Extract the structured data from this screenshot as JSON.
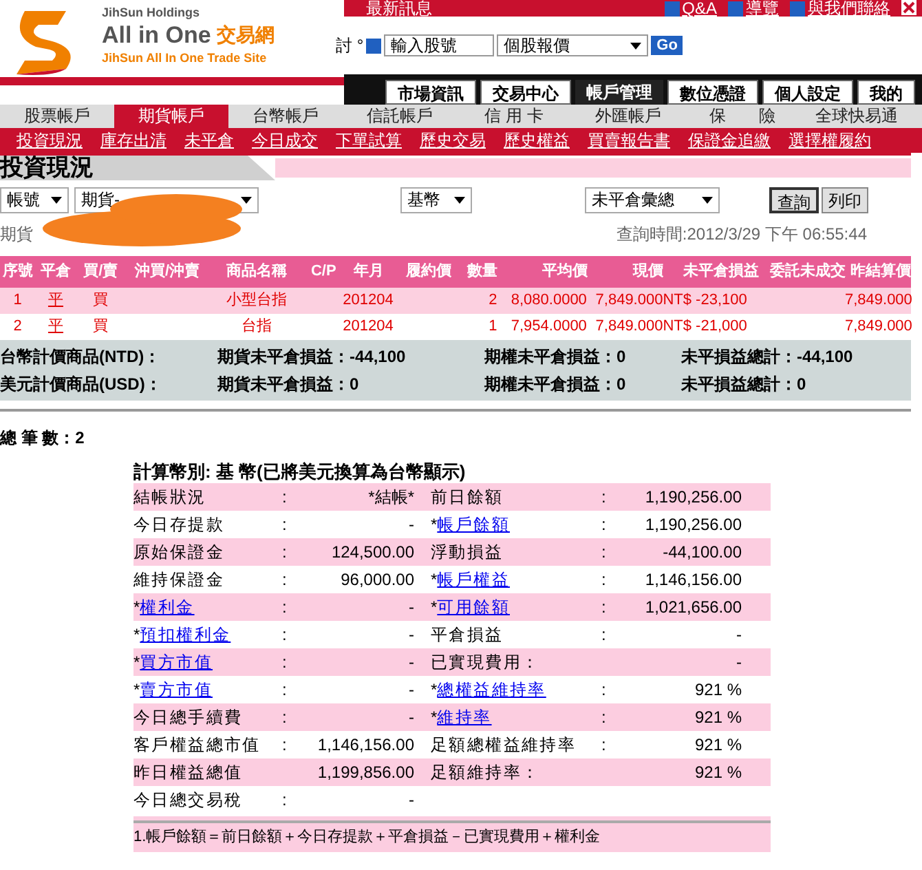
{
  "brand": {
    "holdings": "JihSun Holdings",
    "name": "All in One",
    "name_cjk": "交易網",
    "tagline": "JihSun All In One Trade Site"
  },
  "top_bar": {
    "news": "最新訊息",
    "links": [
      "Q&A",
      "導覽",
      "與我們聯絡"
    ]
  },
  "quote_search": {
    "cut_text": "討 °",
    "input_value": "輸入股號",
    "select_value": "個股報價",
    "button": "Go"
  },
  "main_tabs": [
    {
      "label": "市場資訊",
      "selected": false
    },
    {
      "label": "交易中心",
      "selected": false
    },
    {
      "label": "帳戶管理",
      "selected": true
    },
    {
      "label": "數位憑證",
      "selected": false
    },
    {
      "label": "個人設定",
      "selected": false
    },
    {
      "label": "我的",
      "selected": false
    }
  ],
  "account_tabs": [
    {
      "label": "股票帳戶",
      "selected": false
    },
    {
      "label": "期貨帳戶",
      "selected": true
    },
    {
      "label": "台幣帳戶",
      "selected": false
    },
    {
      "label": "信託帳戶",
      "selected": false
    },
    {
      "label": "信 用 卡",
      "selected": false
    },
    {
      "label": "外匯帳戶",
      "selected": false
    },
    {
      "label": "保　　險",
      "selected": false
    },
    {
      "label": "全球快易通",
      "selected": false
    }
  ],
  "sub_links": [
    "投資現況",
    "庫存出清",
    "未平倉",
    "今日成交",
    "下單試算",
    "歷史交易",
    "歷史權益",
    "買賣報告書",
    "保證金追繳",
    "選擇權履約"
  ],
  "section_title": "投資現況",
  "filters": {
    "account": "帳號",
    "futures_account": "期貨-",
    "currency": "基幣",
    "view": "未平倉彙總",
    "buttons": [
      "查詢",
      "列印"
    ]
  },
  "account_line": "期貨",
  "query_time": "查詢時間:2012/3/29 下午 06:55:44",
  "positions": {
    "columns": [
      "序號",
      "平倉",
      "買/賣",
      "沖買/沖賣",
      "商品名稱",
      "C/P",
      "年月",
      "履約價",
      "數量",
      "平均價",
      "現價",
      "未平倉損益",
      "委託未成交",
      "昨結算價"
    ],
    "rows": [
      {
        "cells": [
          "1",
          "平",
          "買",
          "",
          "小型台指",
          "",
          "201204",
          "",
          "2",
          "8,080.0000",
          "7,849.000",
          "NT$ -23,100",
          "",
          "7,849.000"
        ]
      },
      {
        "cells": [
          "2",
          "平",
          "買",
          "",
          "台指",
          "",
          "201204",
          "",
          "1",
          "7,954.0000",
          "7,849.000",
          "NT$ -21,000",
          "",
          "7,849.000"
        ]
      }
    ]
  },
  "totals": [
    {
      "label": "台幣計價商品(NTD)：",
      "futures": "期貨未平倉損益：-44,100",
      "options": "期權未平倉損益：0",
      "sum": "未平損益總計：-44,100"
    },
    {
      "label": "美元計價商品(USD)：",
      "futures": "期貨未平倉損益：0",
      "options": "期權未平倉損益：0",
      "sum": "未平損益總計：0"
    }
  ],
  "record_count": "總 筆 數：2",
  "equity": {
    "title": "計算幣別: 基 幣(已將美元換算為台幣顯示)",
    "rows": [
      {
        "left": {
          "label": "結帳狀況",
          "colon": ":",
          "value": "*結帳*"
        },
        "right": {
          "label": "前日餘額",
          "colon": ":",
          "value": "1,190,256.00"
        }
      },
      {
        "left": {
          "label": "今日存提款",
          "colon": ":",
          "value": "-"
        },
        "right": {
          "star": "*",
          "label": "帳戶餘額",
          "link": true,
          "colon": ":",
          "value": "1,190,256.00"
        }
      },
      {
        "left": {
          "label": "原始保證金",
          "colon": ":",
          "value": "124,500.00"
        },
        "right": {
          "label": "浮動損益",
          "colon": ":",
          "value": "-44,100.00"
        }
      },
      {
        "left": {
          "label": "維持保證金",
          "colon": ":",
          "value": "96,000.00"
        },
        "right": {
          "star": "*",
          "label": "帳戶權益",
          "link": true,
          "colon": ":",
          "value": "1,146,156.00"
        }
      },
      {
        "left": {
          "star": "*",
          "label": "權利金",
          "link": true,
          "colon": ":",
          "value": "-"
        },
        "right": {
          "star": "*",
          "label": "可用餘額",
          "link": true,
          "colon": ":",
          "value": "1,021,656.00"
        }
      },
      {
        "left": {
          "star": "*",
          "label": "預扣權利金",
          "link": true,
          "colon": ":",
          "value": "-"
        },
        "right": {
          "label": "平倉損益",
          "colon": ":",
          "value": "-"
        }
      },
      {
        "left": {
          "star": "*",
          "label": "買方市值",
          "link": true,
          "colon": ":",
          "value": "-"
        },
        "right": {
          "label": "已實現費用：",
          "value": "-"
        }
      },
      {
        "left": {
          "star": "*",
          "label": "賣方市值",
          "link": true,
          "colon": ":",
          "value": "-"
        },
        "right": {
          "star": "*",
          "label": "總權益維持率",
          "link": true,
          "colon": ":",
          "value": "921 %"
        }
      },
      {
        "left": {
          "label": "今日總手續費",
          "colon": ":",
          "value": "-"
        },
        "right": {
          "star": "*",
          "label": "維持率",
          "link": true,
          "colon": ":",
          "value": "921 %"
        }
      },
      {
        "left": {
          "label": "客戶權益總市值",
          "colon": ":",
          "value": "1,146,156.00"
        },
        "right": {
          "label": "足額總權益維持率",
          "colon": ":",
          "value": "921 %"
        }
      },
      {
        "left": {
          "label": "昨日權益總值",
          "value": "1,199,856.00"
        },
        "right": {
          "label": "足額維持率：",
          "value": "921 %"
        }
      },
      {
        "left": {
          "label": "今日總交易稅",
          "colon": ":",
          "value": "-"
        }
      }
    ],
    "note": "1.帳戶餘額＝前日餘額＋今日存提款＋平倉損益－已實現費用＋權利金"
  }
}
